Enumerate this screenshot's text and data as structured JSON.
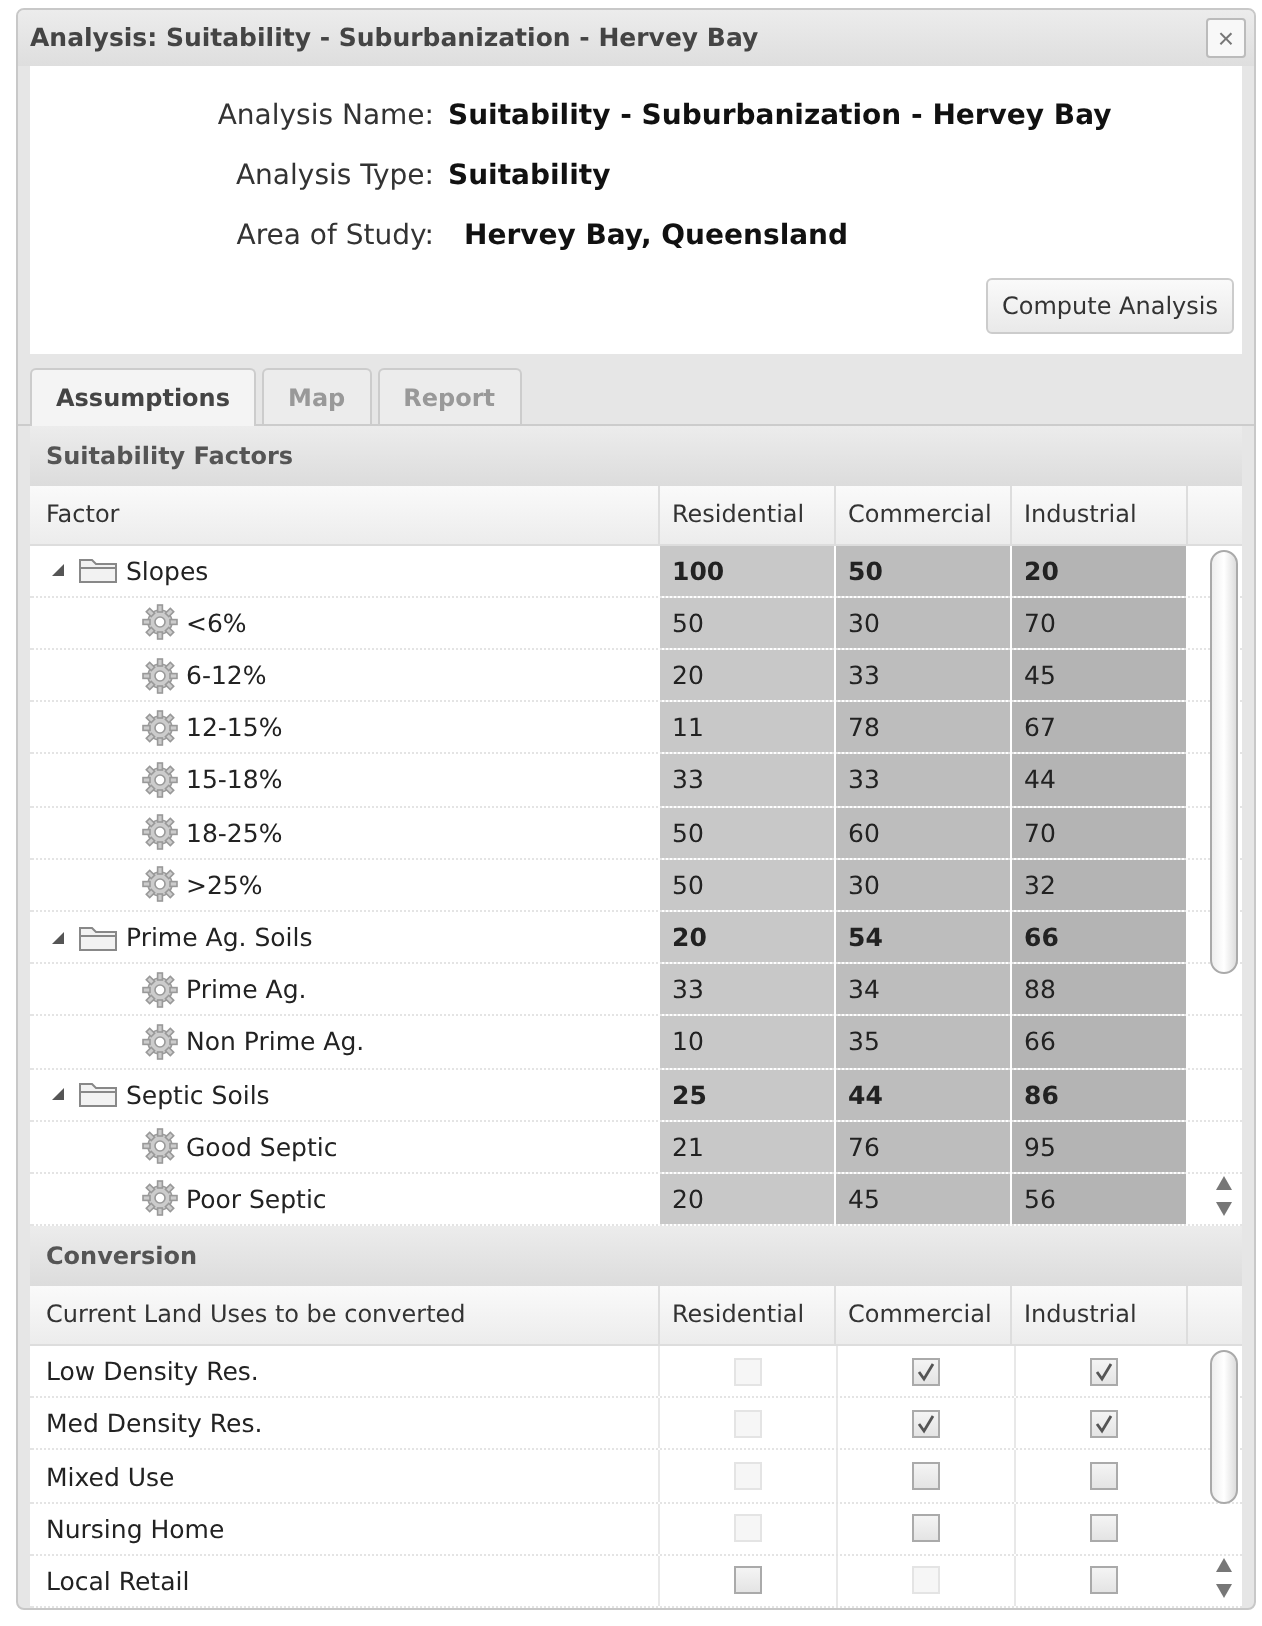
{
  "window": {
    "title": "Analysis: Suitability - Suburbanization - Hervey Bay",
    "close": "×"
  },
  "info": [
    {
      "label": "Analysis Name:",
      "value": "Suitability - Suburbanization - Hervey Bay"
    },
    {
      "label": "Analysis Type:",
      "value": "Suitability"
    },
    {
      "label": "Area of Study:",
      "value": "Hervey Bay, Queensland"
    }
  ],
  "compute_button": "Compute Analysis",
  "tabs": [
    {
      "label": "Assumptions",
      "selected": true
    },
    {
      "label": "Map",
      "selected": false
    },
    {
      "label": "Report",
      "selected": false
    }
  ],
  "factors": {
    "title": "Suitability Factors",
    "columns": [
      "Factor",
      "Residential",
      "Commercial",
      "Industrial"
    ],
    "rows": [
      {
        "name": "Slopes",
        "expanded": true,
        "values": [
          "100",
          "50",
          "20"
        ],
        "children": [
          {
            "name": "<6%",
            "values": [
              "50",
              "30",
              "70"
            ]
          },
          {
            "name": "6-12%",
            "values": [
              "20",
              "33",
              "45"
            ]
          },
          {
            "name": "12-15%",
            "values": [
              "11",
              "78",
              "67"
            ]
          },
          {
            "name": "15-18%",
            "values": [
              "33",
              "33",
              "44"
            ]
          },
          {
            "name": "18-25%",
            "values": [
              "50",
              "60",
              "70"
            ]
          },
          {
            "name": ">25%",
            "values": [
              "50",
              "30",
              "32"
            ]
          }
        ]
      },
      {
        "name": "Prime Ag. Soils",
        "expanded": true,
        "values": [
          "20",
          "54",
          "66"
        ],
        "children": [
          {
            "name": "Prime Ag.",
            "values": [
              "33",
              "34",
              "88"
            ]
          },
          {
            "name": "Non Prime Ag.",
            "values": [
              "10",
              "35",
              "66"
            ]
          }
        ]
      },
      {
        "name": "Septic Soils",
        "expanded": true,
        "values": [
          "25",
          "44",
          "86"
        ],
        "children": [
          {
            "name": "Good Septic",
            "values": [
              "21",
              "76",
              "95"
            ]
          },
          {
            "name": "Poor Septic",
            "values": [
              "20",
              "45",
              "56"
            ]
          }
        ]
      }
    ]
  },
  "conversion": {
    "title": "Conversion",
    "columns": [
      "Current Land Uses to be converted",
      "Residential",
      "Commercial",
      "Industrial"
    ],
    "rows": [
      {
        "name": "Low Density Res.",
        "cells": [
          {
            "checked": false,
            "disabled": true
          },
          {
            "checked": true,
            "disabled": false
          },
          {
            "checked": true,
            "disabled": false
          }
        ]
      },
      {
        "name": "Med Density Res.",
        "cells": [
          {
            "checked": false,
            "disabled": true
          },
          {
            "checked": true,
            "disabled": false
          },
          {
            "checked": true,
            "disabled": false
          }
        ]
      },
      {
        "name": "Mixed Use",
        "cells": [
          {
            "checked": false,
            "disabled": true
          },
          {
            "checked": false,
            "disabled": false
          },
          {
            "checked": false,
            "disabled": false
          }
        ]
      },
      {
        "name": "Nursing Home",
        "cells": [
          {
            "checked": false,
            "disabled": true
          },
          {
            "checked": false,
            "disabled": false
          },
          {
            "checked": false,
            "disabled": false
          }
        ]
      },
      {
        "name": "Local Retail",
        "cells": [
          {
            "checked": false,
            "disabled": false
          },
          {
            "checked": false,
            "disabled": true
          },
          {
            "checked": false,
            "disabled": false
          }
        ]
      }
    ]
  }
}
